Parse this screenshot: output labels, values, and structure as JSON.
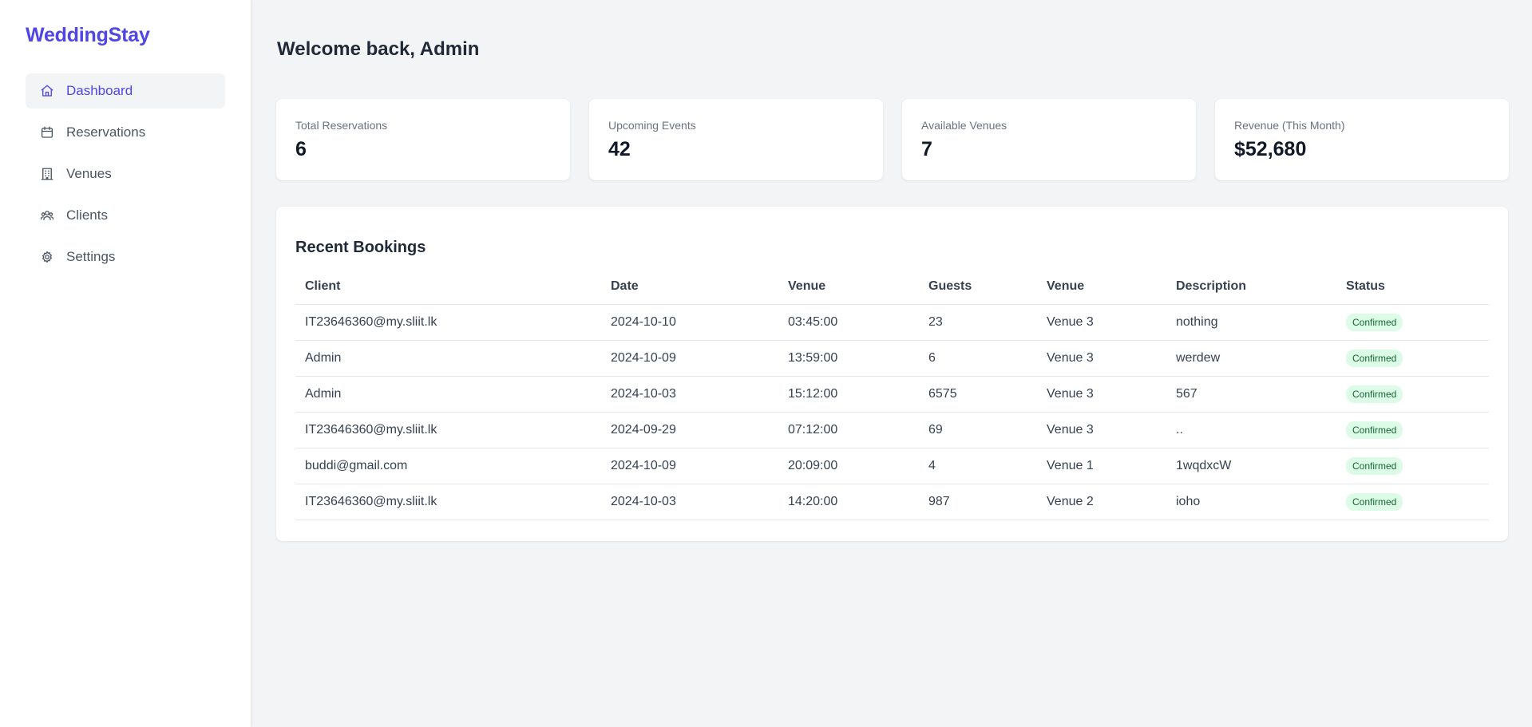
{
  "brand": "WeddingStay",
  "sidebar": {
    "items": [
      {
        "label": "Dashboard",
        "icon": "home-icon"
      },
      {
        "label": "Reservations",
        "icon": "calendar-icon"
      },
      {
        "label": "Venues",
        "icon": "building-icon"
      },
      {
        "label": "Clients",
        "icon": "users-icon"
      },
      {
        "label": "Settings",
        "icon": "gear-icon"
      }
    ],
    "active": "Dashboard"
  },
  "header": {
    "welcome": "Welcome back, Admin"
  },
  "stats": [
    {
      "label": "Total Reservations",
      "value": "6"
    },
    {
      "label": "Upcoming Events",
      "value": "42"
    },
    {
      "label": "Available Venues",
      "value": "7"
    },
    {
      "label": "Revenue (This Month)",
      "value": "$52,680"
    }
  ],
  "bookings": {
    "title": "Recent Bookings",
    "columns": [
      "Client",
      "Date",
      "Venue",
      "Guests",
      "Venue",
      "Description",
      "Status"
    ],
    "rows": [
      [
        "IT23646360@my.sliit.lk",
        "2024-10-10",
        "03:45:00",
        "23",
        "Venue 3",
        "nothing",
        "Confirmed"
      ],
      [
        "Admin",
        "2024-10-09",
        "13:59:00",
        "6",
        "Venue 3",
        "werdew",
        "Confirmed"
      ],
      [
        "Admin",
        "2024-10-03",
        "15:12:00",
        "6575",
        "Venue 3",
        "567",
        "Confirmed"
      ],
      [
        "IT23646360@my.sliit.lk",
        "2024-09-29",
        "07:12:00",
        "69",
        "Venue 3",
        "..",
        "Confirmed"
      ],
      [
        "buddi@gmail.com",
        "2024-10-09",
        "20:09:00",
        "4",
        "Venue 1",
        "1wqdxcW",
        "Confirmed"
      ],
      [
        "IT23646360@my.sliit.lk",
        "2024-10-03",
        "14:20:00",
        "987",
        "Venue 2",
        "ioho",
        "Confirmed"
      ]
    ]
  },
  "colors": {
    "accent": "#4f46e5",
    "status_confirmed_bg": "#dcfce7",
    "status_confirmed_text": "#166534"
  }
}
